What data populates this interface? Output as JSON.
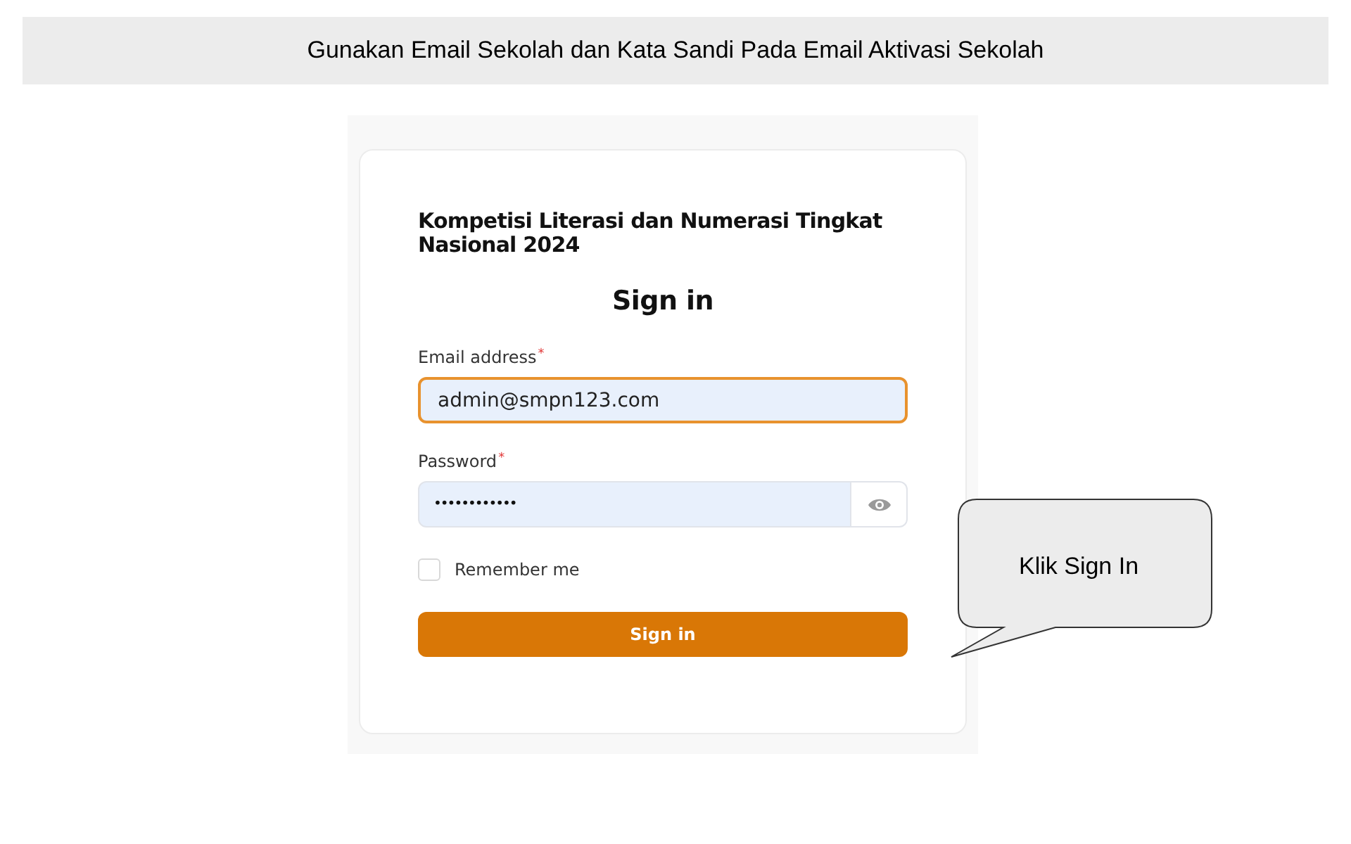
{
  "banner": {
    "text": "Gunakan Email Sekolah dan Kata Sandi Pada Email Aktivasi Sekolah"
  },
  "login": {
    "app_title": "Kompetisi Literasi dan Numerasi Tingkat Nasional 2024",
    "heading": "Sign in",
    "fields": [
      {
        "kind": "text",
        "label": "Email address",
        "required_mark": "*",
        "value": "admin@smpn123.com",
        "focused": true
      },
      {
        "kind": "password",
        "label": "Password",
        "required_mark": "*",
        "value": "••••••••••••",
        "focused": false
      }
    ],
    "remember": {
      "label": "Remember me",
      "checked": false
    },
    "submit": "Sign in"
  },
  "callout": {
    "text": "Klik Sign In"
  }
}
